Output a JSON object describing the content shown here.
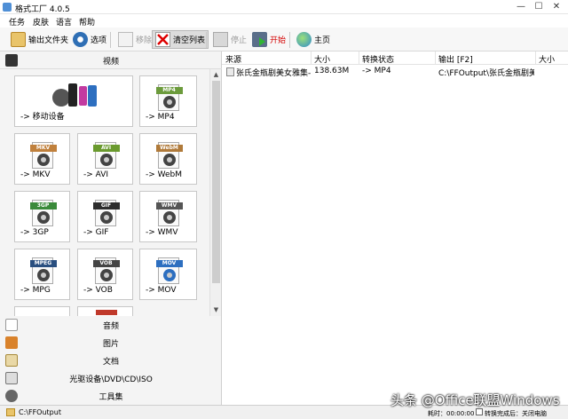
{
  "window": {
    "title": "格式工厂 4.0.5",
    "min": "—",
    "max": "☐",
    "close": "✕"
  },
  "menu": [
    "任务",
    "皮肤",
    "语言",
    "帮助"
  ],
  "toolbar": {
    "output_folder": "输出文件夹",
    "options": "选项",
    "remove": "移除",
    "clear_list": "清空列表",
    "stop": "停止",
    "start": "开始",
    "home": "主页"
  },
  "left": {
    "categories": {
      "video": "视频",
      "audio": "音频",
      "picture": "图片",
      "document": "文档",
      "disc": "光驱设备\\DVD\\CD\\ISO",
      "tools": "工具集"
    },
    "formats": [
      {
        "label": "-> 移动设备",
        "icon": "mobile-devices-icon"
      },
      {
        "label": "-> MP4",
        "tag": "MP4",
        "color": "#6c9b3c"
      },
      {
        "label": "-> MKV",
        "tag": "MKV",
        "color": "#c0803c"
      },
      {
        "label": "-> AVI",
        "tag": "AVI",
        "color": "#6a9a2e"
      },
      {
        "label": "-> WebM",
        "tag": "WebM",
        "color": "#b07a3a"
      },
      {
        "label": "-> 3GP",
        "tag": "3GP",
        "color": "#3a8a3a"
      },
      {
        "label": "-> GIF",
        "tag": "GIF",
        "color": "#2d2d2d"
      },
      {
        "label": "-> WMV",
        "tag": "WMV",
        "color": "#555555"
      },
      {
        "label": "-> MPG",
        "tag": "MPEG",
        "color": "#2a4f80"
      },
      {
        "label": "-> VOB",
        "tag": "VOB",
        "color": "#444444"
      },
      {
        "label": "-> MOV",
        "tag": "MOV",
        "color": "#2d6fc0"
      }
    ]
  },
  "list": {
    "columns": [
      "来源",
      "大小",
      "转换状态",
      "输出 [F2]",
      "大小"
    ],
    "rows": [
      {
        "source": "张氏金瓶剧美女雅集-...",
        "size": "138.63M",
        "status": "-> MP4",
        "output": "C:\\FFOutput\\张氏金瓶剧美...",
        "out_size": ""
      }
    ]
  },
  "status": {
    "path": "C:\\FFOutput",
    "elapsed": "耗时：00:00:00",
    "after": "转换完成后：关闭电脑"
  },
  "watermark": "头条 @Office联盟Windows"
}
